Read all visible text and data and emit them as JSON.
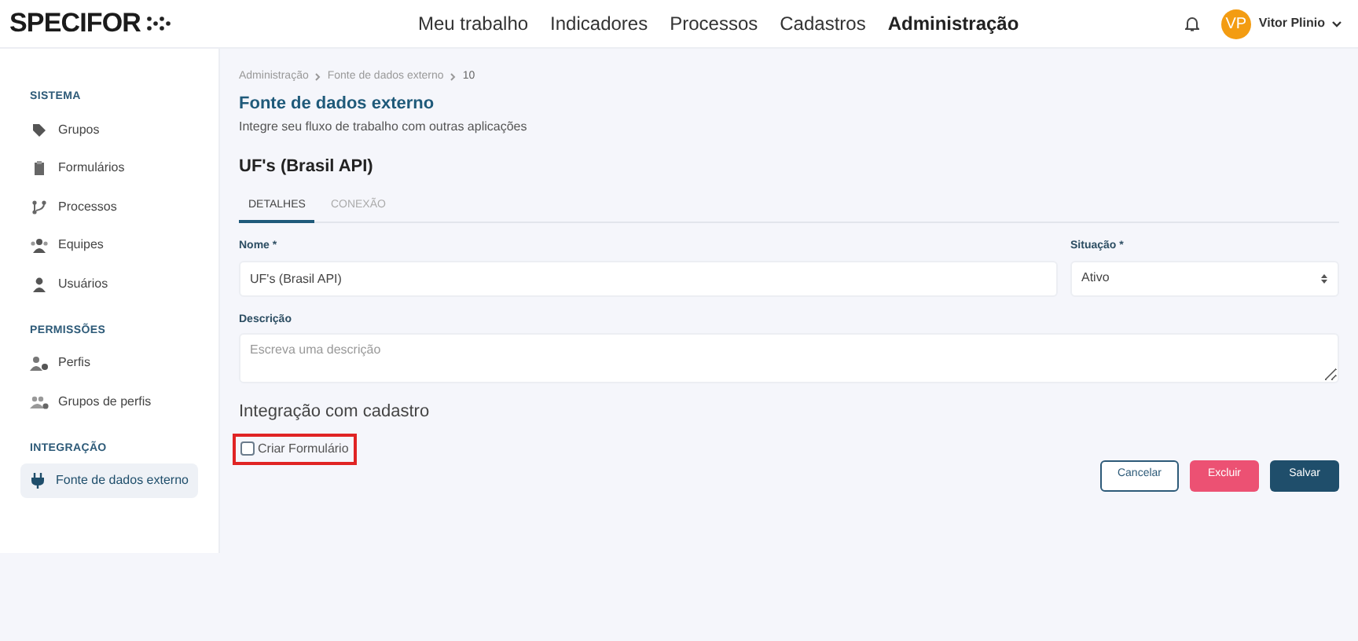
{
  "header": {
    "logo": "SPECIFOR",
    "nav": [
      {
        "label": "Meu trabalho",
        "selected": false
      },
      {
        "label": "Indicadores",
        "selected": false
      },
      {
        "label": "Processos",
        "selected": false
      },
      {
        "label": "Cadastros",
        "selected": false
      },
      {
        "label": "Administração",
        "selected": true
      }
    ],
    "user": {
      "initials": "VP",
      "name": "Vitor Plinio"
    }
  },
  "sidebar": {
    "sections": [
      {
        "title": "SISTEMA",
        "items": [
          {
            "label": "Grupos",
            "selected": false
          },
          {
            "label": "Formulários",
            "selected": false
          },
          {
            "label": "Processos",
            "selected": false
          },
          {
            "label": "Equipes",
            "selected": false
          },
          {
            "label": "Usuários",
            "selected": false
          }
        ]
      },
      {
        "title": "PERMISSÕES",
        "items": [
          {
            "label": "Perfis",
            "selected": false
          },
          {
            "label": "Grupos de perfis",
            "selected": false
          }
        ]
      },
      {
        "title": "INTEGRAÇÃO",
        "items": [
          {
            "label": "Fonte de dados externo",
            "selected": true
          }
        ]
      }
    ]
  },
  "breadcrumb": [
    "Administração",
    "Fonte de dados externo",
    "10"
  ],
  "page_title": "Fonte de dados externo",
  "page_subtitle": "Integre seu fluxo de trabalho com outras aplicações",
  "record_title": "UF's (Brasil API)",
  "tabs": [
    {
      "label": "DETALHES",
      "selected": true
    },
    {
      "label": "CONEXÃO",
      "selected": false
    }
  ],
  "form": {
    "name": {
      "label": "Nome *",
      "value": "UF's (Brasil API)"
    },
    "status": {
      "label": "Situação *",
      "value": "Ativo"
    },
    "description": {
      "label": "Descrição",
      "placeholder": "Escreva uma descrição"
    },
    "section_title": "Integração com cadastro",
    "create_form": {
      "label": "Criar Formulário",
      "checked": false,
      "highlighted": true
    }
  },
  "buttons": [
    {
      "label": "Cancelar",
      "kind": "outline"
    },
    {
      "label": "Excluir",
      "kind": "danger"
    },
    {
      "label": "Salvar",
      "kind": "primary"
    }
  ]
}
